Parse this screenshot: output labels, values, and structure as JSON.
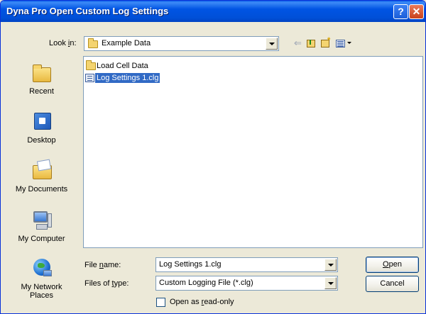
{
  "window": {
    "title": "Dyna Pro Open Custom Log Settings",
    "help_label": "?",
    "close_label": "✕"
  },
  "lookin": {
    "label_pre": "Look ",
    "label_key": "i",
    "label_post": "n:",
    "value": "Example Data"
  },
  "toolbar": {
    "back_label": "⇐"
  },
  "places": {
    "recent": "Recent",
    "desktop": "Desktop",
    "documents": "My Documents",
    "computer": "My Computer",
    "network_line1": "My Network",
    "network_line2": "Places"
  },
  "files": [
    {
      "name": "Load Cell Data",
      "type": "folder",
      "selected": false
    },
    {
      "name": "Log Settings 1.clg",
      "type": "file",
      "selected": true
    }
  ],
  "filename": {
    "label_pre": "File ",
    "label_key": "n",
    "label_post": "ame:",
    "value": "Log Settings 1.clg"
  },
  "filetype": {
    "label_pre": "Files of ",
    "label_key": "t",
    "label_post": "ype:",
    "value": "Custom Logging File (*.clg)"
  },
  "buttons": {
    "open_key": "O",
    "open_rest": "pen",
    "cancel": "Cancel"
  },
  "readonly": {
    "label_pre": "Open as ",
    "label_key": "r",
    "label_post": "ead-only",
    "checked": false
  }
}
